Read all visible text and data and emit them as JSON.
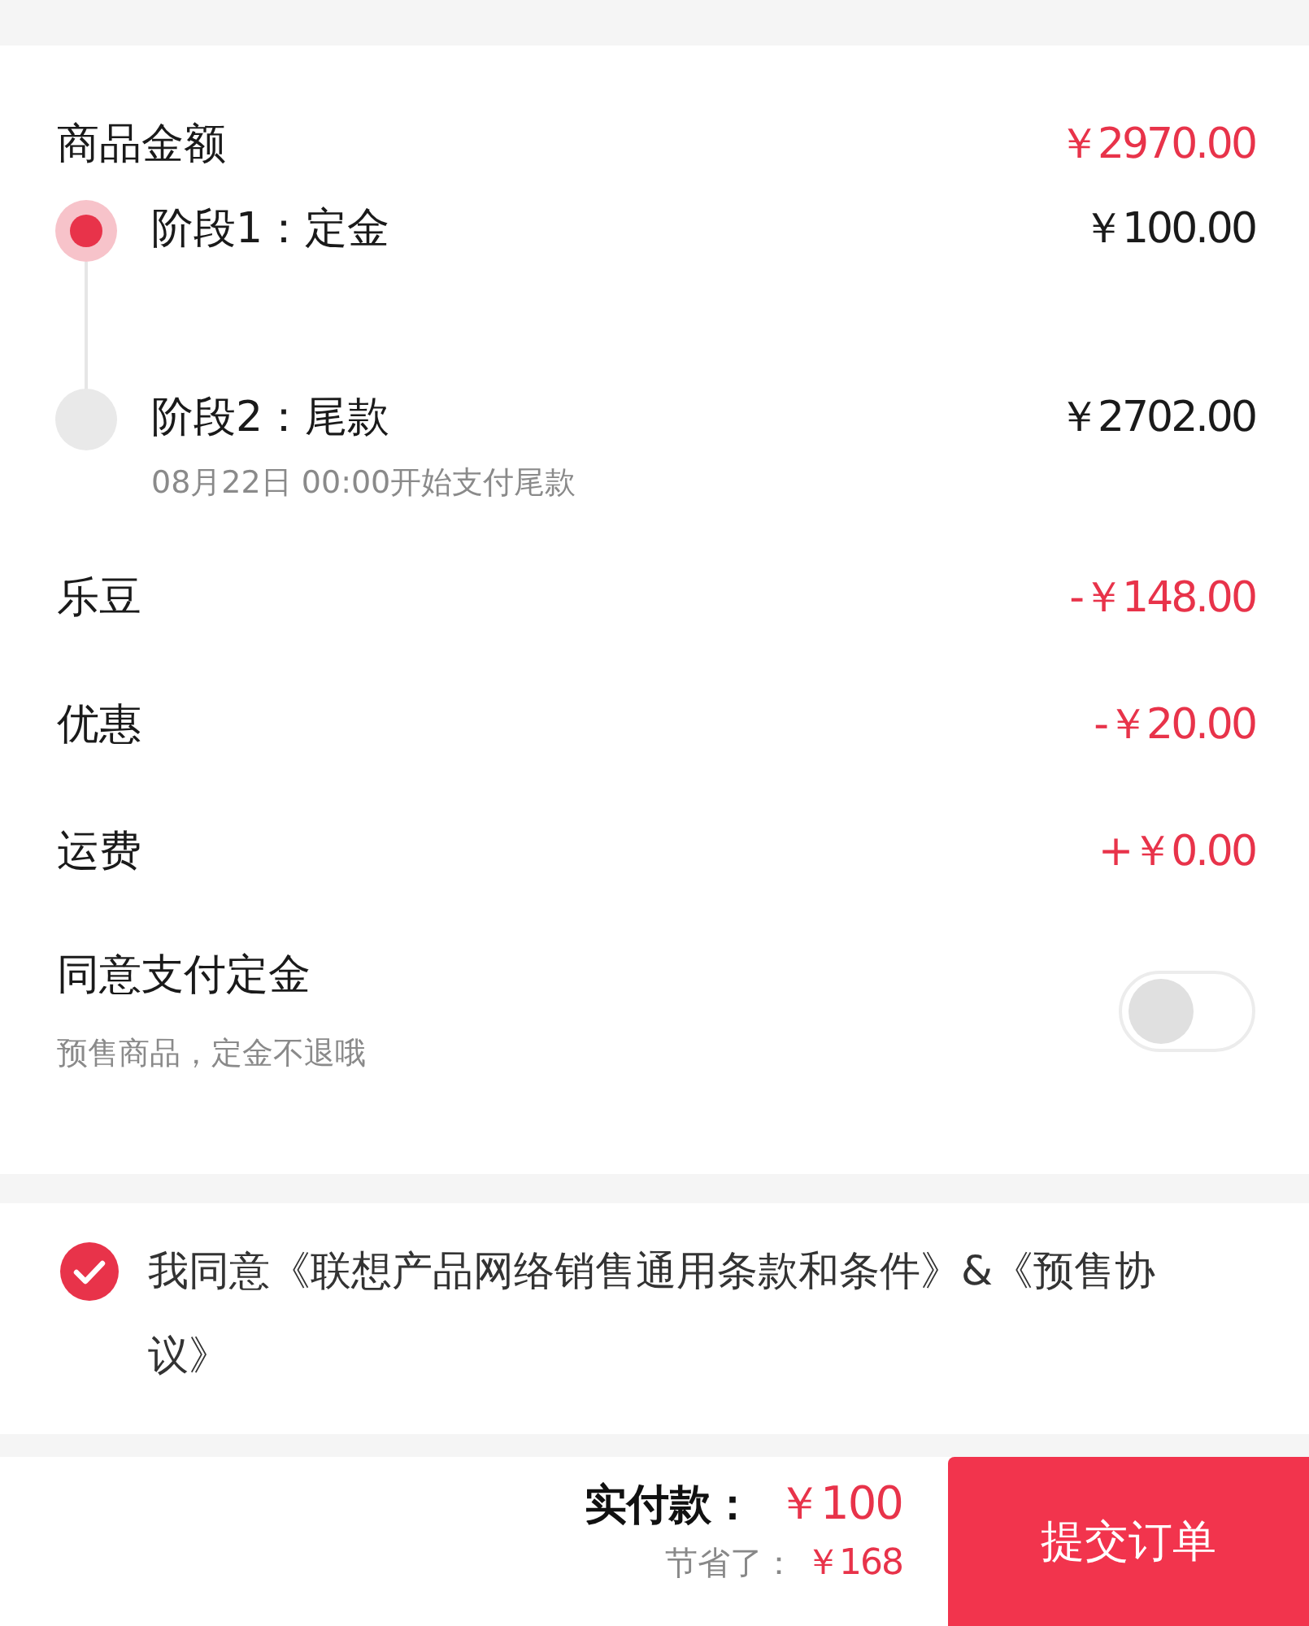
{
  "goods_amount": {
    "label": "商品金额",
    "amount": "￥2970.00",
    "color": "#e8334a"
  },
  "stages": [
    {
      "label": "阶段1：定金",
      "amount": "￥100.00",
      "selected": true
    },
    {
      "label": "阶段2：尾款",
      "amount": "￥2702.00",
      "note": "08月22日 00:00开始支付尾款",
      "selected": false
    }
  ],
  "adjustments": [
    {
      "label": "乐豆",
      "amount": "-￥148.00",
      "color": "#e8334a"
    },
    {
      "label": "优惠",
      "amount": "-￥20.00",
      "color": "#e8334a"
    },
    {
      "label": "运费",
      "amount": "+￥0.00",
      "color": "#e8334a"
    }
  ],
  "deposit_consent": {
    "title": "同意支付定金",
    "subtitle": "预售商品，定金不退哦",
    "on": false
  },
  "agreement": {
    "text": "我同意《联想产品网络销售通用条款和条件》&《预售协议》",
    "checked": true
  },
  "footer": {
    "pay_label": "实付款：",
    "pay_amount": "￥100",
    "saved_label": "节省了：",
    "saved_amount": "￥168",
    "submit": "提交订单"
  }
}
